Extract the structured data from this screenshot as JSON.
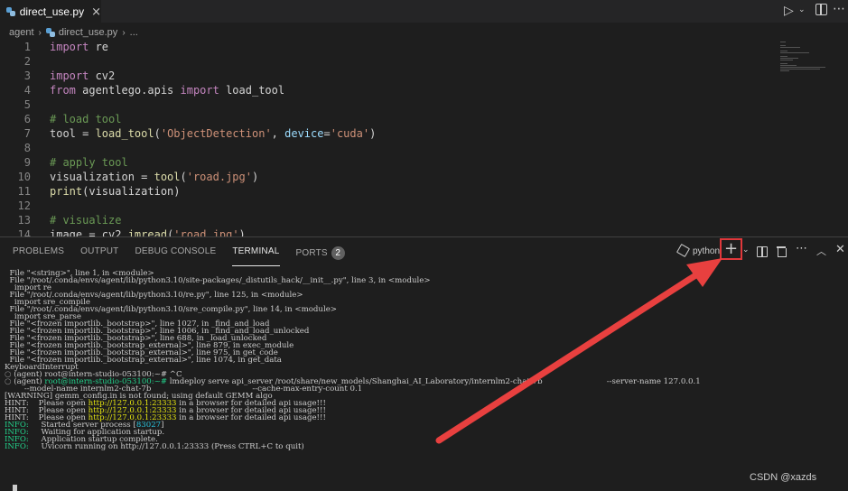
{
  "tab": {
    "filename": "direct_use.py",
    "close": "×"
  },
  "breadcrumb": {
    "folder": "agent",
    "file": "direct_use.py",
    "ellipsis": "..."
  },
  "editor": {
    "lines": [
      {
        "n": "1",
        "code": "import re"
      },
      {
        "n": "2",
        "code": ""
      },
      {
        "n": "3",
        "code": "import cv2"
      },
      {
        "n": "4",
        "code": "from agentlego.apis import load_tool"
      },
      {
        "n": "5",
        "code": ""
      },
      {
        "n": "6",
        "code": "# load tool"
      },
      {
        "n": "7",
        "code": "tool = load_tool('ObjectDetection', device='cuda')"
      },
      {
        "n": "8",
        "code": ""
      },
      {
        "n": "9",
        "code": "# apply tool"
      },
      {
        "n": "10",
        "code": "visualization = tool('road.jpg')"
      },
      {
        "n": "11",
        "code": "print(visualization)"
      },
      {
        "n": "12",
        "code": ""
      },
      {
        "n": "13",
        "code": "# visualize"
      },
      {
        "n": "14",
        "code": "image = cv2.imread('road.jpg')"
      }
    ]
  },
  "panel": {
    "tabs": [
      {
        "label": "PROBLEMS"
      },
      {
        "label": "OUTPUT"
      },
      {
        "label": "DEBUG CONSOLE"
      },
      {
        "label": "TERMINAL"
      },
      {
        "label": "PORTS",
        "badge": "2"
      }
    ],
    "terminal_name": "python"
  },
  "terminal": {
    "lines": [
      "  File \"<string>\", line 1, in <module>",
      "  File \"/root/.conda/envs/agent/lib/python3.10/site-packages/_distutils_hack/__init__.py\", line 3, in <module>",
      "    import re",
      "  File \"/root/.conda/envs/agent/lib/python3.10/re.py\", line 125, in <module>",
      "    import sre_compile",
      "  File \"/root/.conda/envs/agent/lib/python3.10/sre_compile.py\", line 14, in <module>",
      "    import sre_parse",
      "  File \"<frozen importlib._bootstrap>\", line 1027, in _find_and_load",
      "  File \"<frozen importlib._bootstrap>\", line 1006, in _find_and_load_unlocked",
      "  File \"<frozen importlib._bootstrap>\", line 688, in _load_unlocked",
      "  File \"<frozen importlib._bootstrap_external>\", line 879, in exec_module",
      "  File \"<frozen importlib._bootstrap_external>\", line 975, in get_code",
      "  File \"<frozen importlib._bootstrap_external>\", line 1074, in get_data",
      "KeyboardInterrupt"
    ],
    "prompt1": "(agent) root@intern-studio-053100:~# ^C",
    "prompt2_env": "(agent) ",
    "prompt2_host": "root@intern-studio-053100:~#",
    "prompt2_cmd": " lmdeploy serve api_server /root/share/new_models/Shanghai_AI_Laboratory/internlm2-chat-7b                          --server-name 127.0.0.1",
    "cont_line": "        --model-name internlm2-chat-7b                                         --cache-max-entry-count 0.1",
    "warning": "[WARNING] gemm_config.in is not found; using default GEMM algo",
    "hints": [
      {
        "label": "HINT:",
        "pre": "    Please open ",
        "url": "http://127.0.0.1:23333",
        "post": " in a browser for detailed api usage!!!"
      },
      {
        "label": "HINT:",
        "pre": "    Please open ",
        "url": "http://127.0.0.1:23333",
        "post": " in a browser for detailed api usage!!!"
      },
      {
        "label": "HINT:",
        "pre": "    Please open ",
        "url": "http://127.0.0.1:23333",
        "post": " in a browser for detailed api usage!!!"
      }
    ],
    "info": [
      {
        "label": "INFO:",
        "pre": "     Started server process [",
        "pid": "83027",
        "post": "]"
      },
      {
        "label": "INFO:",
        "pre": "     Waiting for application startup.",
        "pid": "",
        "post": ""
      },
      {
        "label": "INFO:",
        "pre": "     Application startup complete.",
        "pid": "",
        "post": ""
      },
      {
        "label": "INFO:",
        "pre": "     Uvicorn running on http://127.0.0.1:23333 (Press CTRL+C to quit)",
        "pid": "",
        "post": ""
      }
    ]
  },
  "watermark": "CSDN @xazds",
  "colors": {
    "annotation": "#e0383b",
    "background": "#1e1e1e"
  }
}
